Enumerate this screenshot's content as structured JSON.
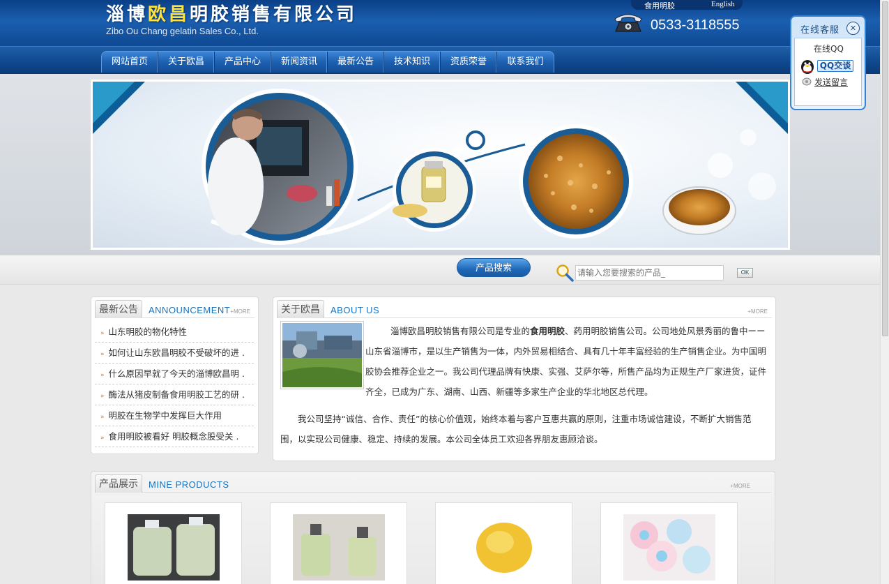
{
  "header": {
    "company_cn_pre": "淄博",
    "company_cn_hl": "欧昌",
    "company_cn_post": "明胶销售有限公司",
    "company_en": "Zibo Ou Chang gelatin Sales Co., Ltd.",
    "lang_cn": "食用明胶",
    "lang_en": "English",
    "phone": "0533-3118555"
  },
  "nav": {
    "items": [
      "网站首页",
      "关于欧昌",
      "产品中心",
      "新闻资讯",
      "最新公告",
      "技术知识",
      "资质荣誉",
      "联系我们"
    ]
  },
  "search": {
    "title": "产品搜索",
    "placeholder": "请输入您要搜索的产品_",
    "ok": "OK"
  },
  "announcements": {
    "title_cn": "最新公告",
    "title_en": "ANNOUNCEMENT",
    "more": "+MORE",
    "items": [
      "山东明胶的物化特性",
      "如何让山东欧昌明胶不受破坏的进 .",
      "什么原因早就了今天的淄博欧昌明 .",
      "酶法从猪皮制备食用明胶工艺的研 .",
      "明胶在生物学中发挥巨大作用",
      "食用明胶被看好 明胶概念股受关 ."
    ]
  },
  "about": {
    "title_cn": "关于欧昌",
    "title_en": "ABOUT US",
    "more": "+MORE",
    "p1_a": "淄博欧昌明胶销售有限公司是专业的",
    "p1_bold": "食用明胶",
    "p1_b": "、药用明胶销售公司。公司地处风景秀丽的鲁中ーー山东省淄博市，是以生产销售为一体，内外贸易相结合、具有几十年丰富经验的生产销售企业。为中国明胶协会推荐企业之一。我公司代理品牌有快康、实强、艾萨尔等，所售产品均为正规生产厂家进货，证件齐全，已成为广东、湖南、山西、新疆等多家生产企业的华北地区总代理。",
    "p2": "我公司坚持“诚信、合作、责任”的核心价值观，始终本着与客户互惠共赢的原则，注重市场诚信建设，不断扩大销售范围，以实现公司健康、稳定、持续的发展。本公司全体员工欢迎各界朋友惠顾洽谈。"
  },
  "products": {
    "title_cn": "产品展示",
    "title_en": "MINE PRODUCTS",
    "more": "+MORE",
    "count": 4
  },
  "qq": {
    "title": "在线客服",
    "label": "在线QQ",
    "btn": "QQ交谈",
    "msg": "发送留言"
  },
  "colors": {
    "header_blue": "#1b5fb0",
    "nav_blue": "#1d5fb0",
    "accent_yellow": "#ffe23a",
    "link_blue": "#1a72bb",
    "arrow_orange": "#e4701e"
  }
}
